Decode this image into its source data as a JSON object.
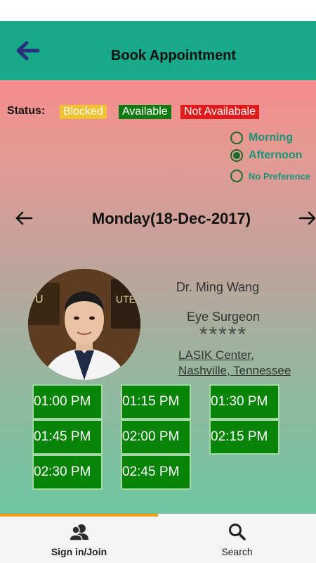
{
  "app_bar": {
    "title": "Book Appointment"
  },
  "status_legend": {
    "label": "Status:",
    "blocked": "Blocked",
    "available": "Available",
    "not_available": "Not Availabale",
    "colors": {
      "blocked": "#f1c232",
      "available": "#0f7a0f",
      "not_available": "#e01b1b"
    }
  },
  "time_preference": {
    "options": [
      {
        "label": "Morning",
        "selected": false
      },
      {
        "label": "Afternoon",
        "selected": true
      },
      {
        "label": "No Preference",
        "selected": false
      }
    ]
  },
  "date_nav": {
    "date": "Monday(18-Dec-2017)"
  },
  "doctor": {
    "name": "Dr. Ming Wang",
    "specialty": "Eye Surgeon",
    "rating": "*****",
    "location_line1": "LASIK Center,",
    "location_line2": "Nashville, Tennessee"
  },
  "slots": [
    "01:00 PM",
    "01:15 PM",
    "01:30 PM",
    "01:45 PM",
    "02:00 PM",
    "02:15 PM",
    "02:30 PM",
    "02:45 PM"
  ],
  "bottom_nav": {
    "signin_label": "Sign in/Join",
    "search_label": "Search",
    "active": "signin"
  },
  "colors": {
    "app_bar": "#18a88a",
    "slot_bg": "#078307",
    "accent": "#f39c12"
  }
}
